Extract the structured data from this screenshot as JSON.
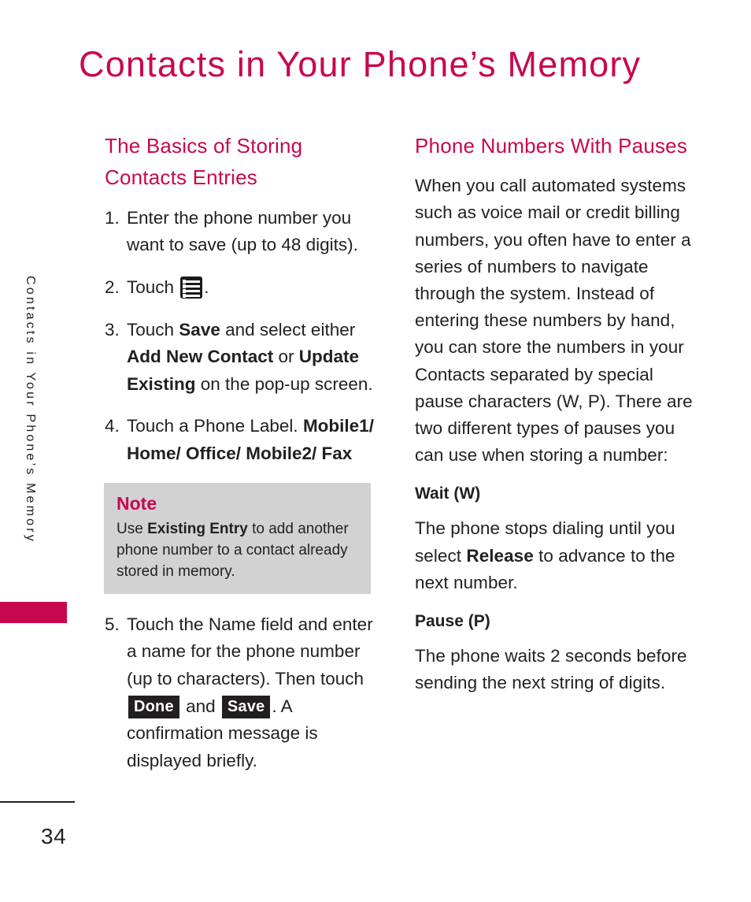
{
  "page": {
    "title": "Contacts in Your Phone’s Memory",
    "number": "34",
    "side_tab_text": "Contacts in Your Phone’s Memory",
    "accent_color": "#C8084F",
    "text_color": "#231F20",
    "note_bg_color": "#D2D2D2"
  },
  "left_column": {
    "heading": "The Basics of Storing Contacts Entries",
    "steps": [
      {
        "num": "1.",
        "parts": [
          {
            "type": "text",
            "value": "Enter the phone number you want to save (up to 48 digits)."
          }
        ]
      },
      {
        "num": "2.",
        "parts": [
          {
            "type": "text",
            "value": "Touch "
          },
          {
            "type": "icon",
            "value": "menu-list-icon"
          },
          {
            "type": "text",
            "value": "."
          }
        ]
      },
      {
        "num": "3.",
        "parts": [
          {
            "type": "text",
            "value": "Touch "
          },
          {
            "type": "bold",
            "value": "Save"
          },
          {
            "type": "text",
            "value": " and select either "
          },
          {
            "type": "bold",
            "value": "Add New Contact"
          },
          {
            "type": "text",
            "value": " or "
          },
          {
            "type": "bold",
            "value": "Update Existing"
          },
          {
            "type": "text",
            "value": " on the pop-up screen."
          }
        ]
      },
      {
        "num": "4.",
        "parts": [
          {
            "type": "text",
            "value": "Touch a Phone Label. "
          },
          {
            "type": "bold",
            "value": "Mobile1/ Home/ Office/ Mobile2/ Fax"
          }
        ]
      },
      {
        "num": "5.",
        "parts": [
          {
            "type": "text",
            "value": "Touch the Name field and enter a name for the phone number (up to  characters). Then touch "
          },
          {
            "type": "badge",
            "value": "Done"
          },
          {
            "type": "text",
            "value": " and "
          },
          {
            "type": "badge",
            "value": "Save"
          },
          {
            "type": "text",
            "value": ". A confirmation message is displayed briefly."
          }
        ]
      }
    ],
    "note": {
      "title": "Note",
      "parts": [
        {
          "type": "text",
          "value": "Use "
        },
        {
          "type": "bold",
          "value": "Existing Entry"
        },
        {
          "type": "text",
          "value": " to add another phone number to a contact already stored in memory."
        }
      ]
    }
  },
  "right_column": {
    "heading": "Phone Numbers With Pauses",
    "intro": "When you call automated systems such as voice mail or credit billing numbers, you often have to enter a series of numbers to navigate through the system. Instead of entering these numbers by hand, you can store the numbers in your Contacts separated by special pause characters (W, P). There are two different types of pauses you can use when storing a number:",
    "subsections": [
      {
        "heading": "Wait (W)",
        "parts": [
          {
            "type": "text",
            "value": "The phone stops dialing until you select "
          },
          {
            "type": "bold",
            "value": "Release"
          },
          {
            "type": "text",
            "value": " to advance to the next number."
          }
        ]
      },
      {
        "heading": "Pause (P)",
        "parts": [
          {
            "type": "text",
            "value": "The phone waits 2 seconds before sending the next string of digits."
          }
        ]
      }
    ]
  }
}
